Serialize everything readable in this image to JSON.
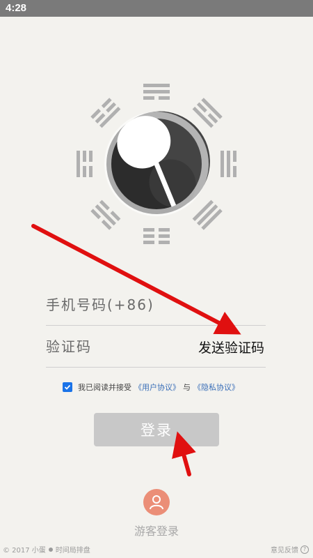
{
  "status_bar": {
    "time": "4:28"
  },
  "form": {
    "phone_placeholder": "手机号码(+86)",
    "code_placeholder": "验证码",
    "send_code_label": "发送验证码"
  },
  "agreement": {
    "checked": true,
    "prefix": "我已阅读并接受",
    "user_agreement": "《用户协议》",
    "connector": "与",
    "privacy_agreement": "《隐私协议》"
  },
  "login_button": {
    "label": "登录"
  },
  "guest": {
    "label": "游客登录",
    "icon": "user-icon"
  },
  "footer": {
    "copyright": "© 2017 小蛋",
    "app_name": "时间局排盘",
    "feedback": "意见反馈"
  },
  "colors": {
    "checkbox": "#1a73e8",
    "link": "#3a6fb8",
    "login_button": "#c8c8c8",
    "guest_avatar": "#eb8e77",
    "annotation_arrow": "#e01010"
  }
}
